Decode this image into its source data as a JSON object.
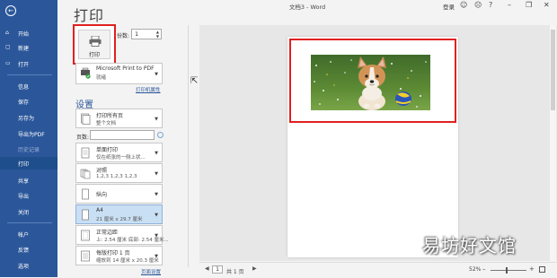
{
  "window": {
    "title": "文档3 - Word",
    "login": "登录"
  },
  "sidebar": {
    "items": [
      {
        "label": "开始",
        "icon": "home-icon"
      },
      {
        "label": "新建",
        "icon": "new-doc-icon"
      },
      {
        "label": "打开",
        "icon": "folder-icon"
      },
      {
        "label": "信息"
      },
      {
        "label": "保存"
      },
      {
        "label": "另存为"
      },
      {
        "label": "导出为PDF"
      },
      {
        "label": "历史记录"
      },
      {
        "label": "打印"
      },
      {
        "label": "共享"
      },
      {
        "label": "导出"
      },
      {
        "label": "关闭"
      },
      {
        "label": "帐户"
      },
      {
        "label": "反馈"
      },
      {
        "label": "选项"
      }
    ],
    "selected": "打印"
  },
  "print": {
    "title": "打印",
    "print_button": "打印",
    "copies_label": "份数:",
    "copies_value": "1",
    "printer_name": "Microsoft Print to PDF",
    "printer_status": "就绪",
    "printer_props_link": "打印机属性",
    "settings_heading": "设置",
    "pages_label": "页数:",
    "pages_value": "",
    "settings": [
      {
        "line1": "打印所有页",
        "line2": "整个文档"
      },
      {
        "line1": "单面打印",
        "line2": "仅在纸张的一侧上状..."
      },
      {
        "line1": "对照",
        "line2": "1,2,3    1,2,3    1,2,3"
      },
      {
        "line1": "纵向",
        "line2": ""
      },
      {
        "line1": "A4",
        "line2": "21 厘米 x 29.7 厘米"
      },
      {
        "line1": "正常边距",
        "line2": "上: 2.54 厘米 底部: 2.54 厘米..."
      },
      {
        "line1": "每版打印 1 页",
        "line2": "缩放到 14 厘米 x 20.3 厘米"
      }
    ],
    "page_setup_link": "页面设置"
  },
  "preview": {
    "current_page": "1",
    "total_pages": "共 1 页",
    "zoom": "52%"
  },
  "watermark": "易坊好文馆"
}
